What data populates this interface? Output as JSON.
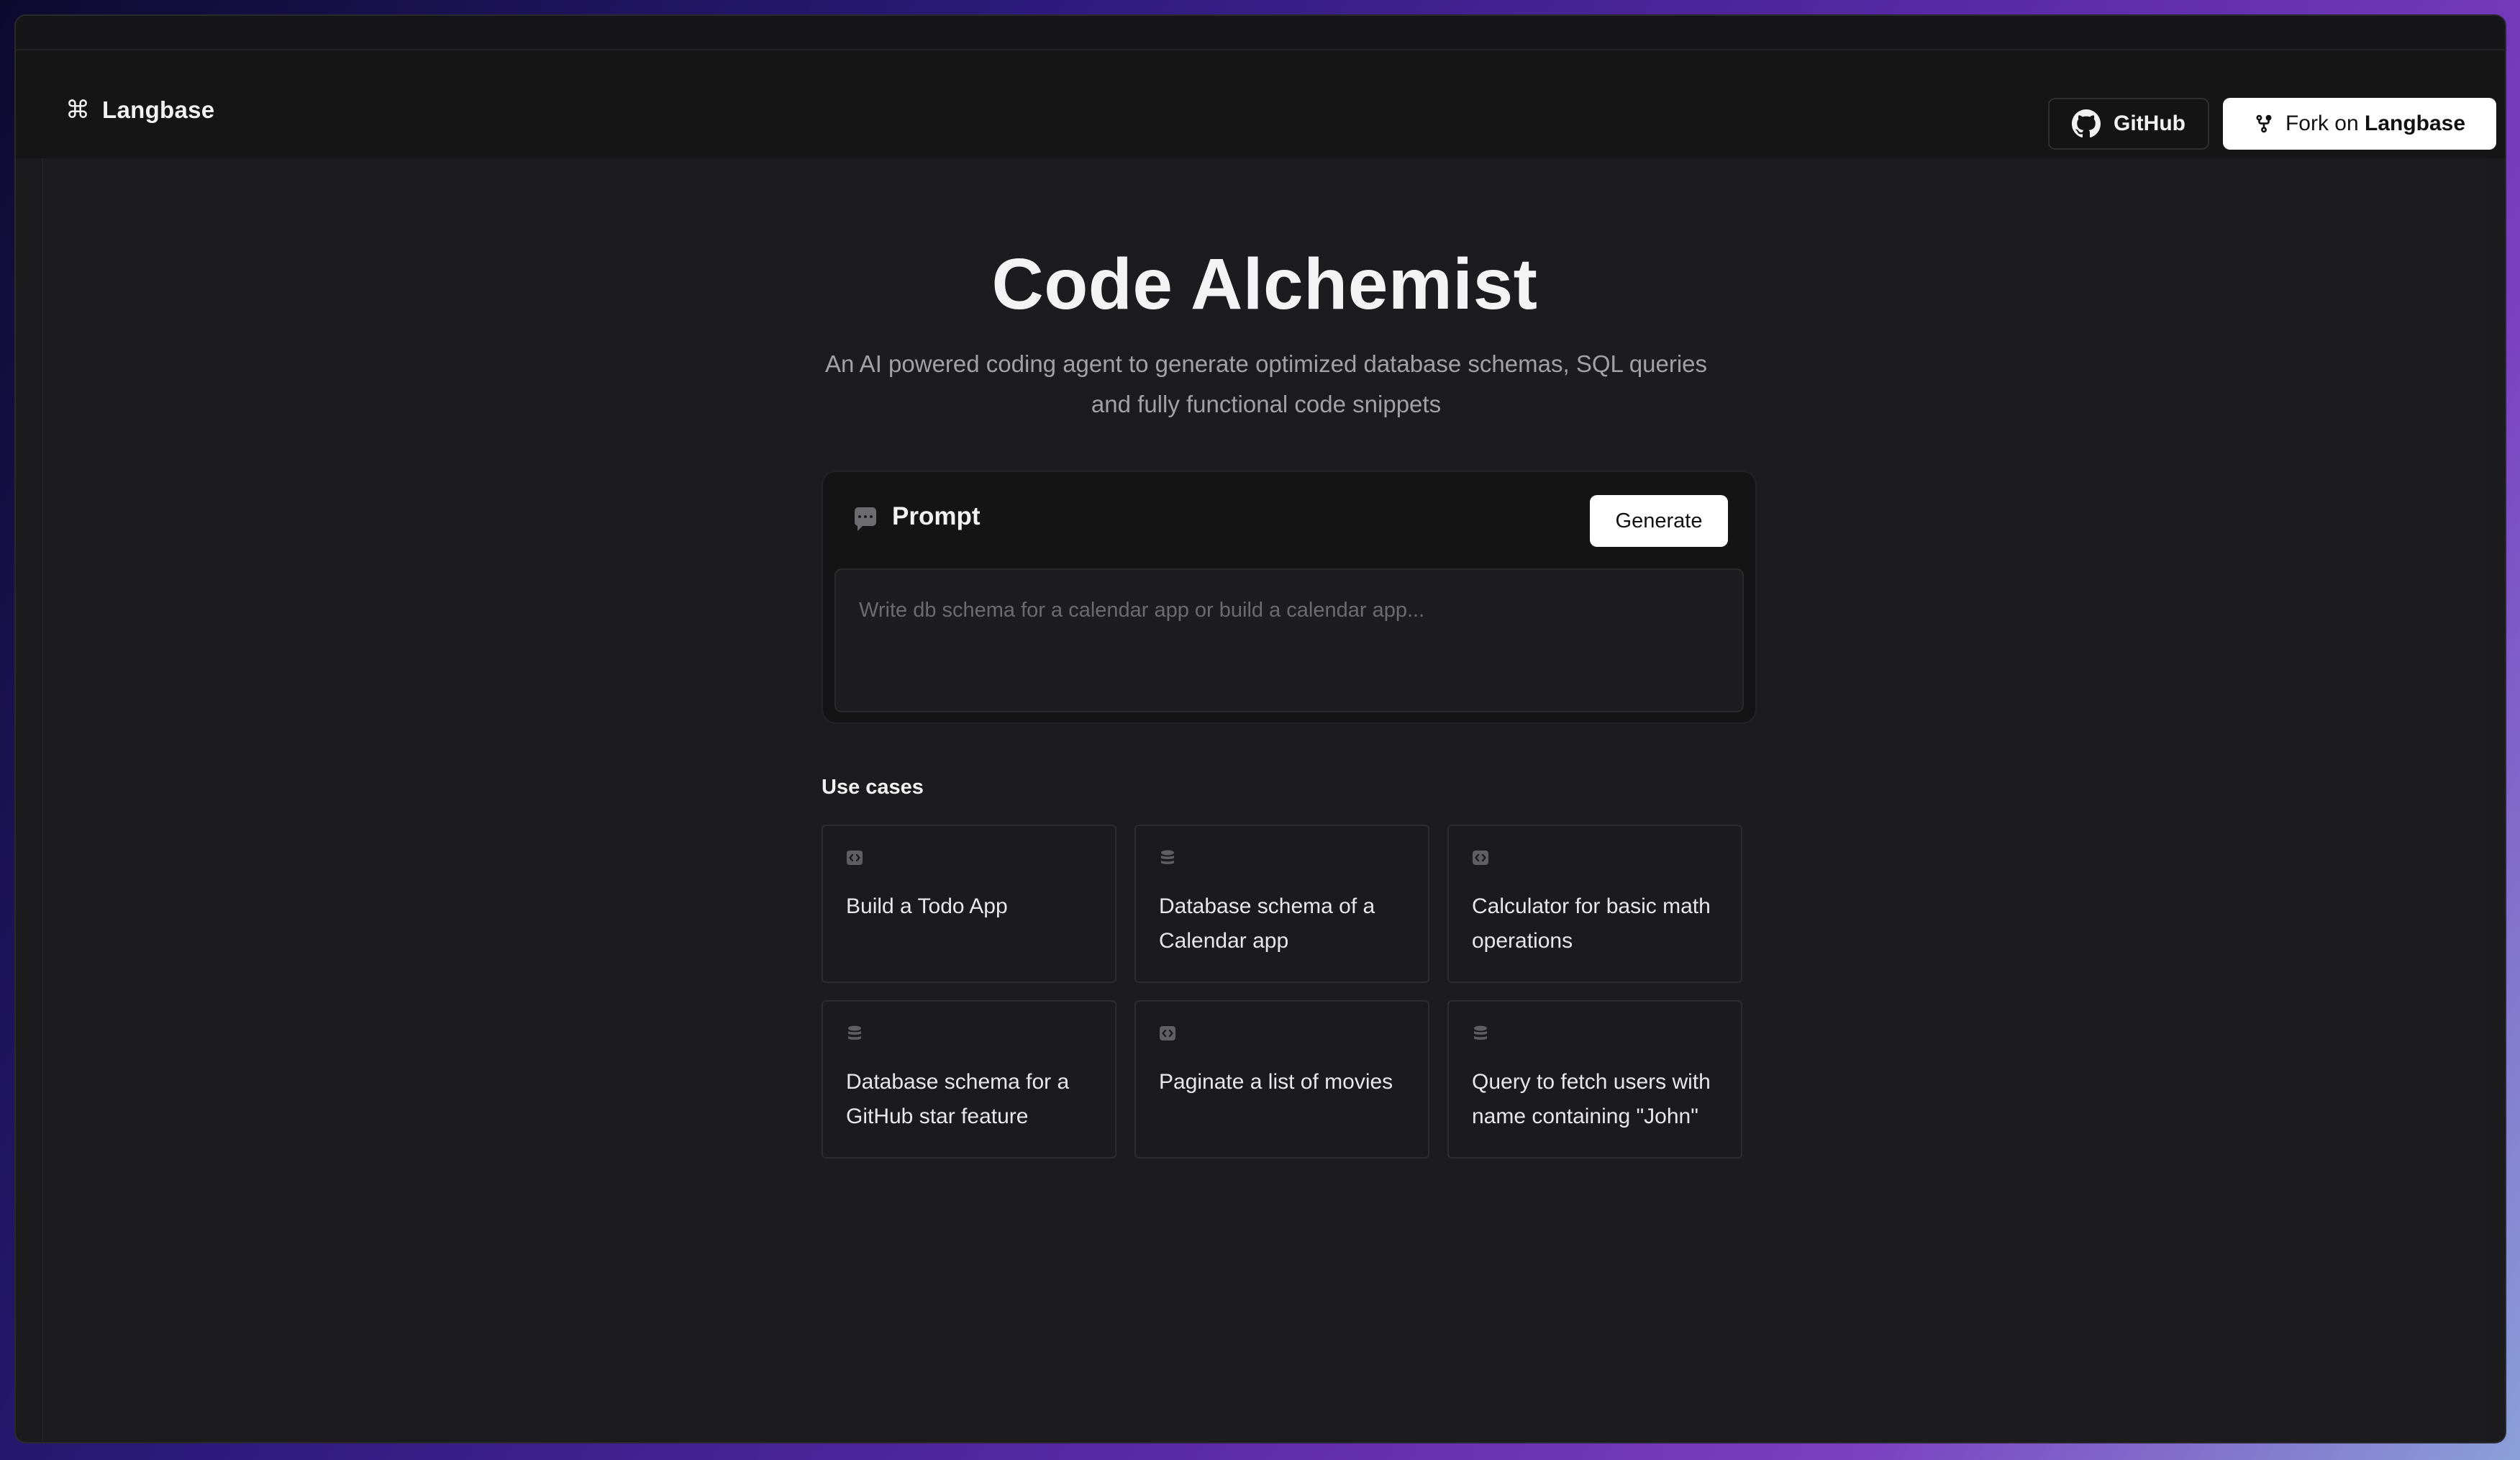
{
  "header": {
    "brand": {
      "icon": "command-icon",
      "label": "Langbase"
    },
    "github_button": {
      "icon": "github-icon",
      "label": "GitHub"
    },
    "fork_button": {
      "icon": "fork-icon",
      "label_prefix": "Fork on",
      "label_bold": "Langbase"
    }
  },
  "hero": {
    "title": "Code Alchemist",
    "subtitle": "An AI powered coding agent to generate optimized database schemas, SQL queries and fully functional code snippets"
  },
  "prompt": {
    "icon": "chat-icon",
    "label": "Prompt",
    "generate_label": "Generate",
    "placeholder": "Write db schema for a calendar app or build a calendar app..."
  },
  "use_cases": {
    "label": "Use cases",
    "items": [
      {
        "icon": "code-icon",
        "text": "Build a Todo App"
      },
      {
        "icon": "database-icon",
        "text": "Database schema of a Calendar app"
      },
      {
        "icon": "code-icon",
        "text": "Calculator for basic math operations"
      },
      {
        "icon": "database-icon",
        "text": "Database schema for a GitHub star feature"
      },
      {
        "icon": "code-icon",
        "text": "Paginate a list of movies"
      },
      {
        "icon": "database-icon",
        "text": "Query to fetch users with name containing \"John\""
      }
    ]
  },
  "colors": {
    "background": "#1c1c1e",
    "header": "#151516",
    "card": "#141415",
    "accent_button": "#ffffff",
    "muted_text": "#a2a2a6"
  }
}
